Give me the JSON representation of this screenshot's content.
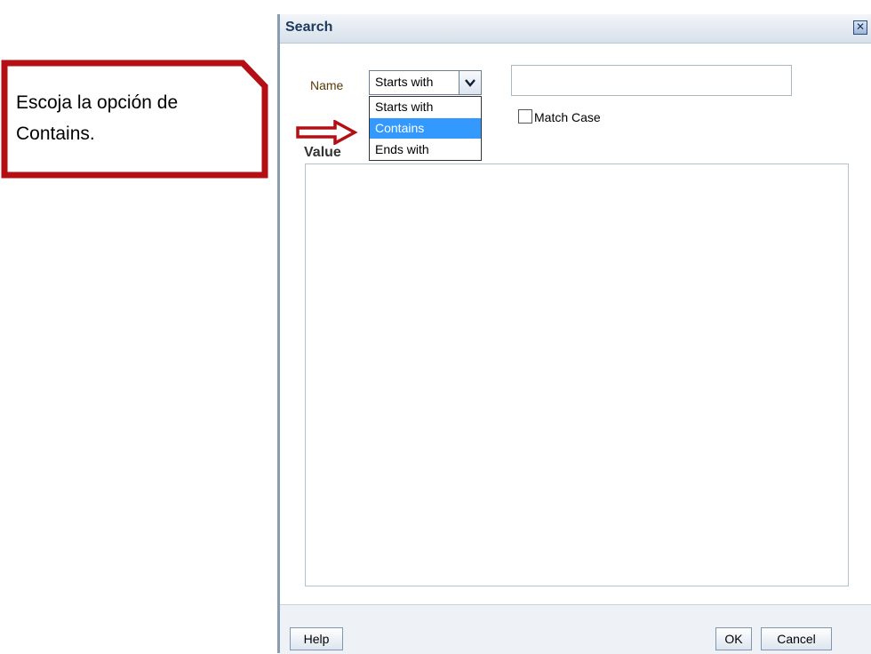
{
  "callout": {
    "text": "Escoja la opción de Contains.",
    "border_color": "#b30f14"
  },
  "dialog": {
    "title": "Search",
    "close_icon": "close-icon"
  },
  "form": {
    "name_label": "Name",
    "operator_selected": "Starts with",
    "operator_options": [
      "Starts with",
      "Contains",
      "Ends with"
    ],
    "highlighted_option": "Contains",
    "search_value": "",
    "match_case_label": "Match Case",
    "match_case_checked": false,
    "value_label": "Value",
    "value_text": ""
  },
  "footer": {
    "help_label": "Help",
    "ok_label": "OK",
    "cancel_label": "Cancel"
  },
  "colors": {
    "highlight": "#3399ff",
    "arrow": "#b30f14",
    "title_text": "#1c3a5e"
  }
}
